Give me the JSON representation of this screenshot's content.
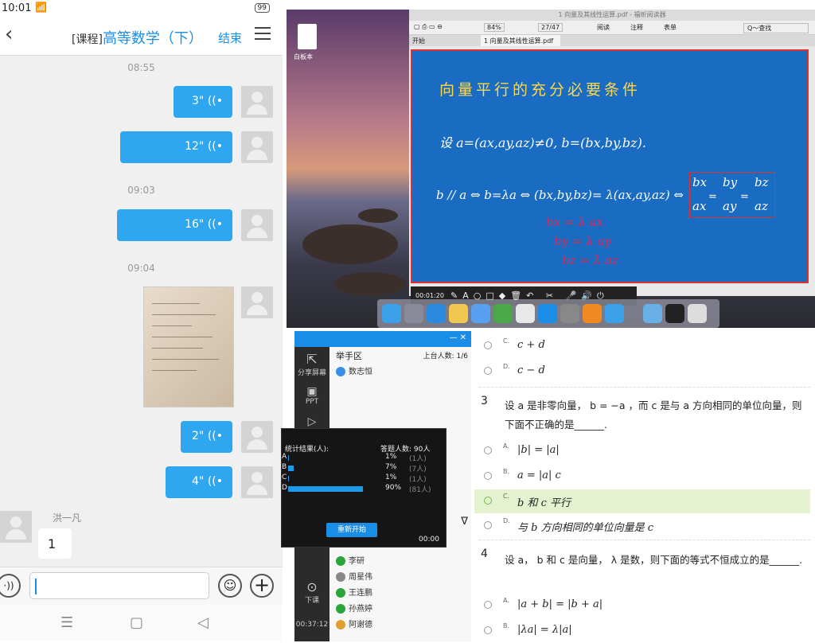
{
  "status": {
    "time": "10:01",
    "signal": "📶",
    "battery": "99"
  },
  "chat": {
    "title_prefix": "[课程]",
    "title": "高等数学（下）",
    "end_label": "结束",
    "ts1": "08:55",
    "ts2": "09:03",
    "ts3": "09:04",
    "voice1": "3\" ((•",
    "voice2": "12\" ((•",
    "voice3": "16\" ((•",
    "voice4": "2\" ((•",
    "voice5": "4\" ((•",
    "other_name": "洪一凡",
    "other_msg": "1"
  },
  "pdf": {
    "window_title": "1 向量及其线性运算.pdf - 福昕阅读器",
    "zoom": "84%",
    "page": "27/47",
    "btn_read": "阅读",
    "btn_note": "注释",
    "btn_form": "表单",
    "search": "Q～查找",
    "tab_start": "开始",
    "tab_file": "1 向量及其线性运算.pdf"
  },
  "slide": {
    "heading": "向量平行的充分必要条件",
    "line1": "设  a=(ax,ay,az)≠0,   b=(bx,by,bz).",
    "line2": "b // a ⇔ b=λa ⇔ (bx,by,bz)= λ(ax,ay,az) ⇔",
    "frac1_n": "bx",
    "frac1_d": "ax",
    "frac2_n": "by",
    "frac2_d": "ay",
    "frac3_n": "bz",
    "frac3_d": "az",
    "hw1": "bx = λ ax",
    "hw2": "by = λ ay",
    "hw3": "bz = λ az"
  },
  "rec": {
    "time": "00:01:20"
  },
  "desktop": {
    "icon_label": "白板本"
  },
  "tool": {
    "share_label": "分享屏幕",
    "ppt_label": "PPT",
    "handup_label": "举手区",
    "online": "上台人数: 1/6",
    "first_student": "数志恒",
    "class_end_label": "下课",
    "duration": "00:37:12",
    "students": [
      "李研",
      "周星伟",
      "王连鹏",
      "孙燕婷",
      "阿谢德"
    ]
  },
  "stats": {
    "title": "统计结果(人):",
    "answered": "答题人数: 90人",
    "rows": [
      {
        "label": "A",
        "pct": "1%",
        "count": "(1人)",
        "value": 1
      },
      {
        "label": "B",
        "pct": "7%",
        "count": "(7人)",
        "value": 7
      },
      {
        "label": "C",
        "pct": "1%",
        "count": "(1人)",
        "value": 1
      },
      {
        "label": "D",
        "pct": "90%",
        "count": "(81人)",
        "value": 90
      }
    ],
    "restart": "重新开始",
    "timer": "00:00"
  },
  "quiz": {
    "optC_prev": "c + d",
    "optD_prev": "c − d",
    "q3_num": "3",
    "q3_text": "设 a 是非零向量， b = −a ，而 c 是与 a 方向相同的单位向量，则下面不正确的是______.",
    "q3_A": "|b| = |a|",
    "q3_B": "a = |a| c",
    "q3_C": "b 和 c 平行",
    "q3_D": "与 b 方向相同的单位向量是 c",
    "q4_num": "4",
    "q4_text": "设 a， b 和 c 是向量， λ 是数，则下面的等式不恒成立的是______.",
    "q4_A": "|a + b| = |b + a|",
    "q4_B": "|λa| = λ|a|"
  }
}
